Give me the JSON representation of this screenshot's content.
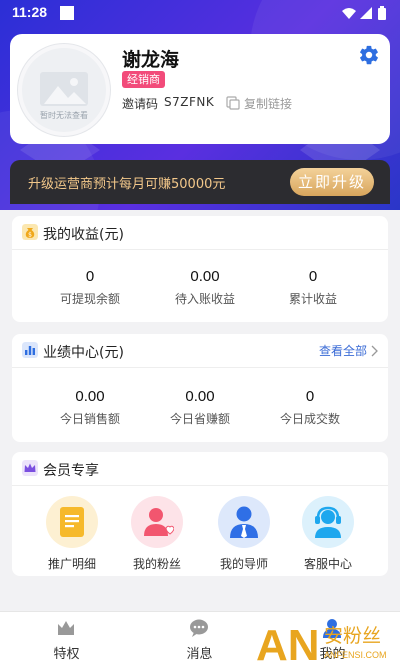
{
  "status_bar": {
    "time": "11:28"
  },
  "profile": {
    "name": "谢龙海",
    "role_badge": "经销商",
    "invite_label": "邀请码",
    "invite_code": "S7ZFNK",
    "copy_link": "复制链接",
    "avatar_placeholder": "暂时无法查看",
    "icons": {
      "settings": "gear-icon",
      "copy": "copy-icon",
      "avatar": "image-placeholder-icon"
    }
  },
  "upgrade": {
    "text": "升级运营商预计每月可赚50000元",
    "button": "立即升级"
  },
  "earnings": {
    "title": "我的收益(元)",
    "icon": "money-bag-icon",
    "items": [
      {
        "value": "0",
        "label": "可提现余额"
      },
      {
        "value": "0.00",
        "label": "待入账收益"
      },
      {
        "value": "0",
        "label": "累计收益"
      }
    ]
  },
  "performance": {
    "title": "业绩中心(元)",
    "icon": "bar-chart-icon",
    "view_all": "查看全部",
    "items": [
      {
        "value": "0.00",
        "label": "今日销售额"
      },
      {
        "value": "0.00",
        "label": "今日省赚额"
      },
      {
        "value": "0",
        "label": "今日成交数"
      }
    ]
  },
  "member": {
    "title": "会员专享",
    "icon": "crown-icon",
    "items": [
      {
        "label": "推广明细",
        "icon": "document-icon",
        "color": "#f6b92b"
      },
      {
        "label": "我的粉丝",
        "icon": "fans-icon",
        "color": "#f2566f"
      },
      {
        "label": "我的导师",
        "icon": "mentor-icon",
        "color": "#2f6fe6"
      },
      {
        "label": "客服中心",
        "icon": "headset-icon",
        "color": "#1ea7ee"
      }
    ]
  },
  "tabbar": {
    "tabs": [
      {
        "label": "特权",
        "icon": "crown-tab-icon"
      },
      {
        "label": "消息",
        "icon": "chat-bubble-icon"
      },
      {
        "label": "我的",
        "icon": "user-tab-icon"
      }
    ]
  },
  "watermark": {
    "brand": "AN",
    "text": "安粉丝",
    "sub": "ANFENSI.COM"
  },
  "colors": {
    "hero_start": "#2b2fd6",
    "hero_end": "#5a2fe0",
    "accent_blue": "#3a6bd6",
    "badge_pink": "#f24b7a",
    "gold": "#f3c88a",
    "dark": "#2c2c30"
  }
}
